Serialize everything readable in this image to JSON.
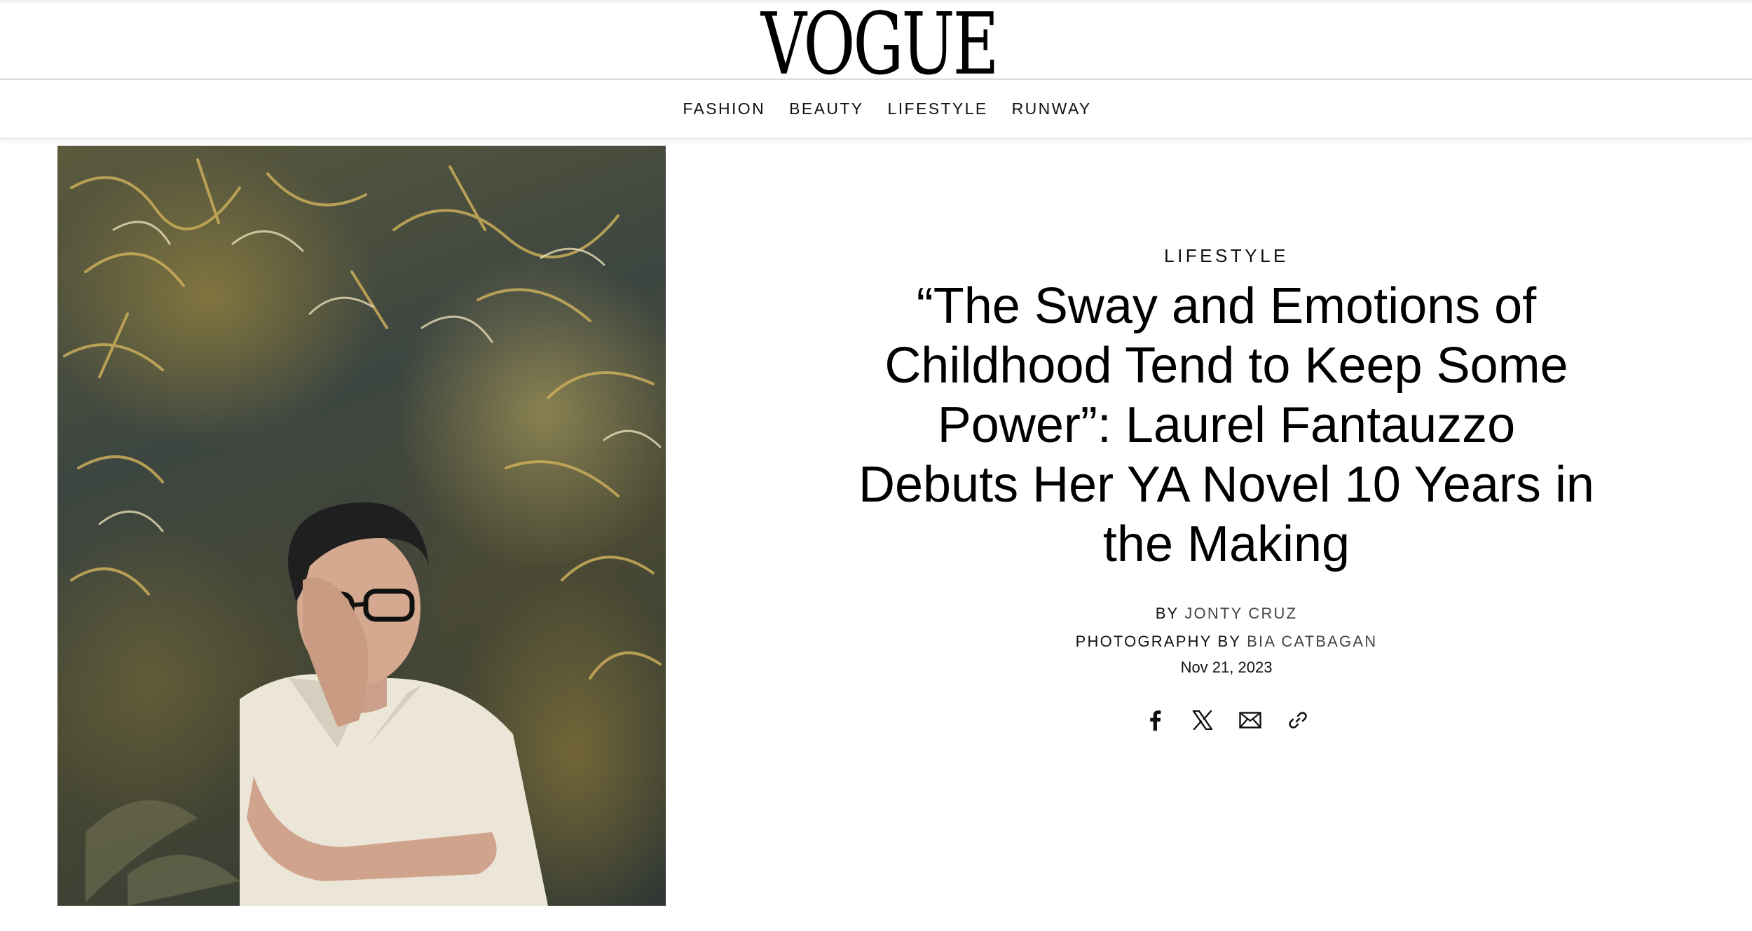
{
  "brand": {
    "logo_text": "VOGUE"
  },
  "nav": {
    "items": [
      {
        "label": "FASHION"
      },
      {
        "label": "BEAUTY"
      },
      {
        "label": "LIFESTYLE"
      },
      {
        "label": "RUNWAY"
      }
    ]
  },
  "hero": {
    "icon": "portrait-photo"
  },
  "article": {
    "category": "LIFESTYLE",
    "headline": "“The Sway and Emotions of Childhood Tend to Keep Some Power”: Laurel Fantauzzo Debuts Her YA Novel 10 Years in the Making",
    "byline_prefix": "BY",
    "author": "JONTY CRUZ",
    "photo_prefix": "PHOTOGRAPHY BY",
    "photographer": "BIA CATBAGAN",
    "date": "Nov 21, 2023"
  },
  "share": {
    "icons": [
      "facebook-icon",
      "x-icon",
      "email-icon",
      "link-icon"
    ]
  },
  "colors": {
    "text": "#000000",
    "divider": "#dcdcdc",
    "background": "#ffffff"
  }
}
